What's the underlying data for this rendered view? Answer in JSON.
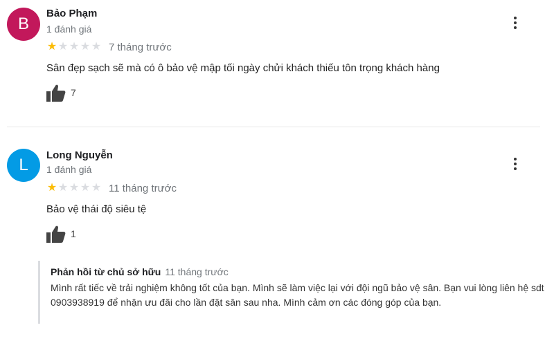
{
  "reviews": [
    {
      "avatar_letter": "B",
      "avatar_color": "#c2185b",
      "name": "Bảo Phạm",
      "review_count": "1 đánh giá",
      "rating": 1,
      "max_rating": 5,
      "time": "7 tháng trước",
      "text": "Sân đẹp sạch sẽ mà có ô bảo vệ mập tối ngày chửi khách thiếu tôn trọng khách hàng",
      "likes": "7"
    },
    {
      "avatar_letter": "L",
      "avatar_color": "#039be5",
      "name": "Long Nguyễn",
      "review_count": "1 đánh giá",
      "rating": 1,
      "max_rating": 5,
      "time": "11 tháng trước",
      "text": "Bảo vệ thái độ siêu tệ",
      "likes": "1"
    }
  ],
  "owner_reply": {
    "title": "Phản hồi từ chủ sở hữu",
    "time": "11 tháng trước",
    "text": "Mình rất tiếc về trải nghiệm không tốt của bạn. Mình sẽ làm việc lại với đội ngũ bảo vệ sân. Bạn vui lòng liên hệ sdt 0903938919 để nhận ưu đãi cho lần đặt sân sau nha. Mình cảm ơn các đóng góp của bạn."
  },
  "colors": {
    "star_filled": "#fbbc04",
    "star_empty": "#dadce0"
  },
  "icons": {
    "like": "thumbs-up-icon",
    "menu": "more-vert-icon"
  }
}
